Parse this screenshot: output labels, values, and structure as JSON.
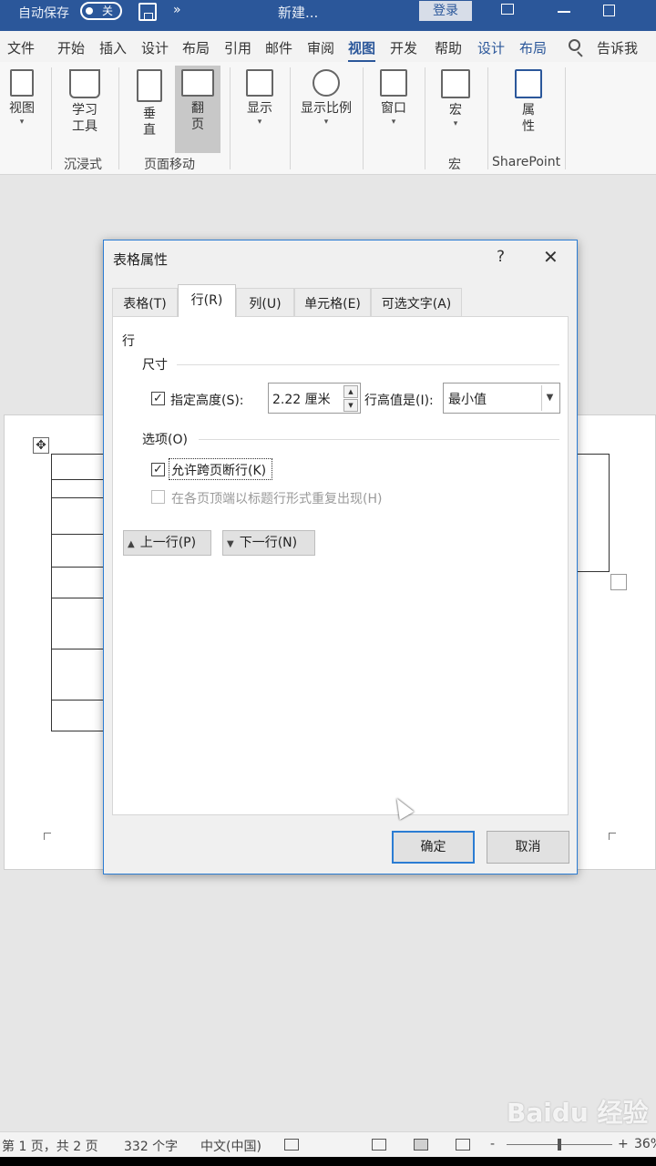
{
  "titlebar": {
    "autosave_label": "自动保存",
    "autosave_state": "关",
    "doc_title": "新建...",
    "login_label": "登录",
    "more_glyph": "»"
  },
  "tabs": [
    "文件",
    "开始",
    "插入",
    "设计",
    "布局",
    "引用",
    "邮件",
    "审阅",
    "视图",
    "开发",
    "帮助",
    "设计",
    "布局"
  ],
  "tabs_active": "视图",
  "tell_me": "告诉我",
  "ribbon": {
    "view_btn": "视图",
    "learning_tools": [
      "学习",
      "工具"
    ],
    "vertical": [
      "垂",
      "直"
    ],
    "side_to_side": [
      "翻",
      "页"
    ],
    "show": "显示",
    "zoom": "显示比例",
    "window": "窗口",
    "macros": "宏",
    "properties": [
      "属",
      "性"
    ],
    "groups": {
      "immersive": "沉浸式",
      "page_move": "页面移动",
      "macros": "宏",
      "sharepoint": "SharePoint"
    }
  },
  "dialog": {
    "title": "表格属性",
    "help": "?",
    "close": "✕",
    "tabs": [
      "表格(T)",
      "行(R)",
      "列(U)",
      "单元格(E)",
      "可选文字(A)"
    ],
    "active_tab": "行(R)",
    "row_header": "行",
    "size_section": "尺寸",
    "specify_height_label": "指定高度(S):",
    "specify_height_checked": true,
    "height_value": "2.22 厘米",
    "row_height_is_label": "行高值是(I):",
    "row_height_is_value": "最小值",
    "options_section": "选项(O)",
    "allow_break_label": "允许跨页断行(K)",
    "allow_break_checked": true,
    "repeat_header_label": "在各页顶端以标题行形式重复出现(H)",
    "repeat_header_checked": false,
    "prev_row": "上一行(P)",
    "next_row": "下一行(N)",
    "ok": "确定",
    "cancel": "取消"
  },
  "statusbar": {
    "page": "第 1 页，共 2 页",
    "words": "332 个字",
    "language": "中文(中国)",
    "zoom": "36%",
    "zoom_minus": "-",
    "zoom_plus": "+"
  },
  "watermark": "Baidu 经验"
}
